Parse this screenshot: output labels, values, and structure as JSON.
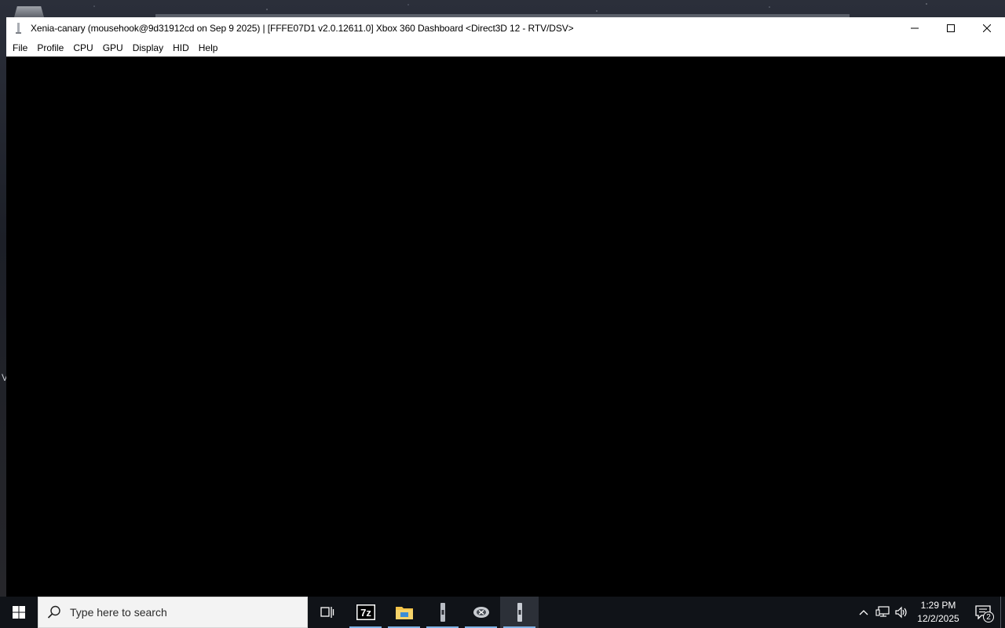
{
  "window": {
    "title": "Xenia-canary (mousehook@9d31912cd on Sep  9 2025) | [FFFE07D1 v2.0.12611.0] Xbox 360 Dashboard <Direct3D 12 - RTV/DSV>",
    "icon": "xenia-icon"
  },
  "menu": {
    "items": [
      "File",
      "Profile",
      "CPU",
      "GPU",
      "Display",
      "HID",
      "Help"
    ]
  },
  "desktop": {
    "edge_letter": "V"
  },
  "taskbar": {
    "search_placeholder": "Type here to search",
    "apps": [
      {
        "name": "task-view-icon"
      },
      {
        "name": "7zip-icon",
        "label": "7z"
      },
      {
        "name": "file-explorer-icon"
      },
      {
        "name": "xenia-icon"
      },
      {
        "name": "xbox-icon"
      },
      {
        "name": "xenia-icon"
      }
    ],
    "clock": {
      "time": "1:29 PM",
      "date": "12/2/2025"
    },
    "notification_count": "2"
  },
  "colors": {
    "taskbar_bg": "#101318",
    "accent_underline": "#7fb3e6",
    "titlebar_bg": "#ffffff",
    "content_bg": "#000000"
  }
}
